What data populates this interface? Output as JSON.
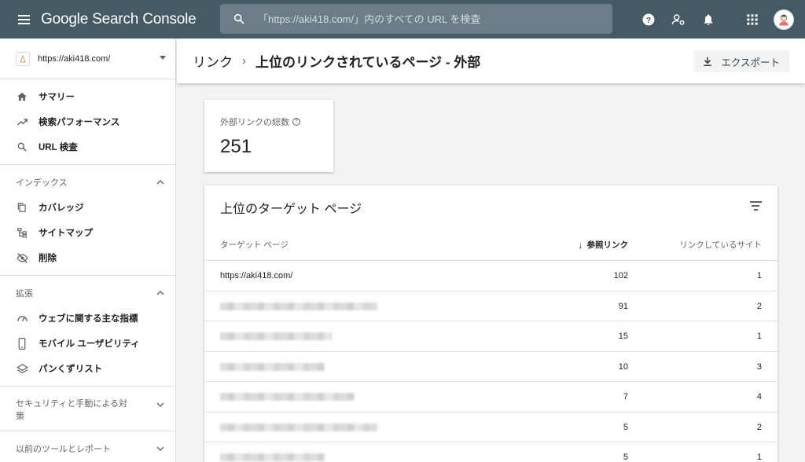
{
  "app": {
    "title": "Google Search Console"
  },
  "search": {
    "placeholder": "「https://aki418.com/」内のすべての URL を検査"
  },
  "property": {
    "url": "https://aki418.com/"
  },
  "sidebar": {
    "items": [
      {
        "label": "サマリー",
        "icon": "home-icon"
      },
      {
        "label": "検索パフォーマンス",
        "icon": "trending-up-icon"
      },
      {
        "label": "URL 検査",
        "icon": "search-icon"
      }
    ],
    "index_section": {
      "title": "インデックス",
      "items": [
        {
          "label": "カバレッジ",
          "icon": "copy-icon"
        },
        {
          "label": "サイトマップ",
          "icon": "sitemap-icon"
        },
        {
          "label": "削除",
          "icon": "eye-off-icon"
        }
      ]
    },
    "enhance_section": {
      "title": "拡張",
      "items": [
        {
          "label": "ウェブに関する主な指標",
          "icon": "speedometer-icon"
        },
        {
          "label": "モバイル ユーザビリティ",
          "icon": "phone-icon"
        },
        {
          "label": "パンくずリスト",
          "icon": "layers-icon"
        }
      ]
    },
    "security_section": {
      "title": "セキュリティと手動による対策"
    },
    "legacy_section": {
      "title": "以前のツールとレポート"
    }
  },
  "header": {
    "breadcrumb_root": "リンク",
    "breadcrumb_current": "上位のリンクされているページ - 外部",
    "export_label": "エクスポート"
  },
  "summary": {
    "label": "外部リンクの総数",
    "value": "251"
  },
  "table": {
    "title": "上位のターゲット ページ",
    "columns": {
      "target": "ターゲット ページ",
      "refs": "参照リンク",
      "sites": "リンクしているサイト"
    },
    "rows": [
      {
        "url": "https://aki418.com/",
        "refs": "102",
        "sites": "1"
      },
      {
        "url": "",
        "refs": "91",
        "sites": "2"
      },
      {
        "url": "",
        "refs": "15",
        "sites": "1"
      },
      {
        "url": "",
        "refs": "10",
        "sites": "3"
      },
      {
        "url": "",
        "refs": "7",
        "sites": "4"
      },
      {
        "url": "",
        "refs": "5",
        "sites": "2"
      },
      {
        "url": "",
        "refs": "5",
        "sites": "1"
      }
    ]
  },
  "colors": {
    "topbar": "#455a64",
    "accent": "#1a73e8"
  }
}
